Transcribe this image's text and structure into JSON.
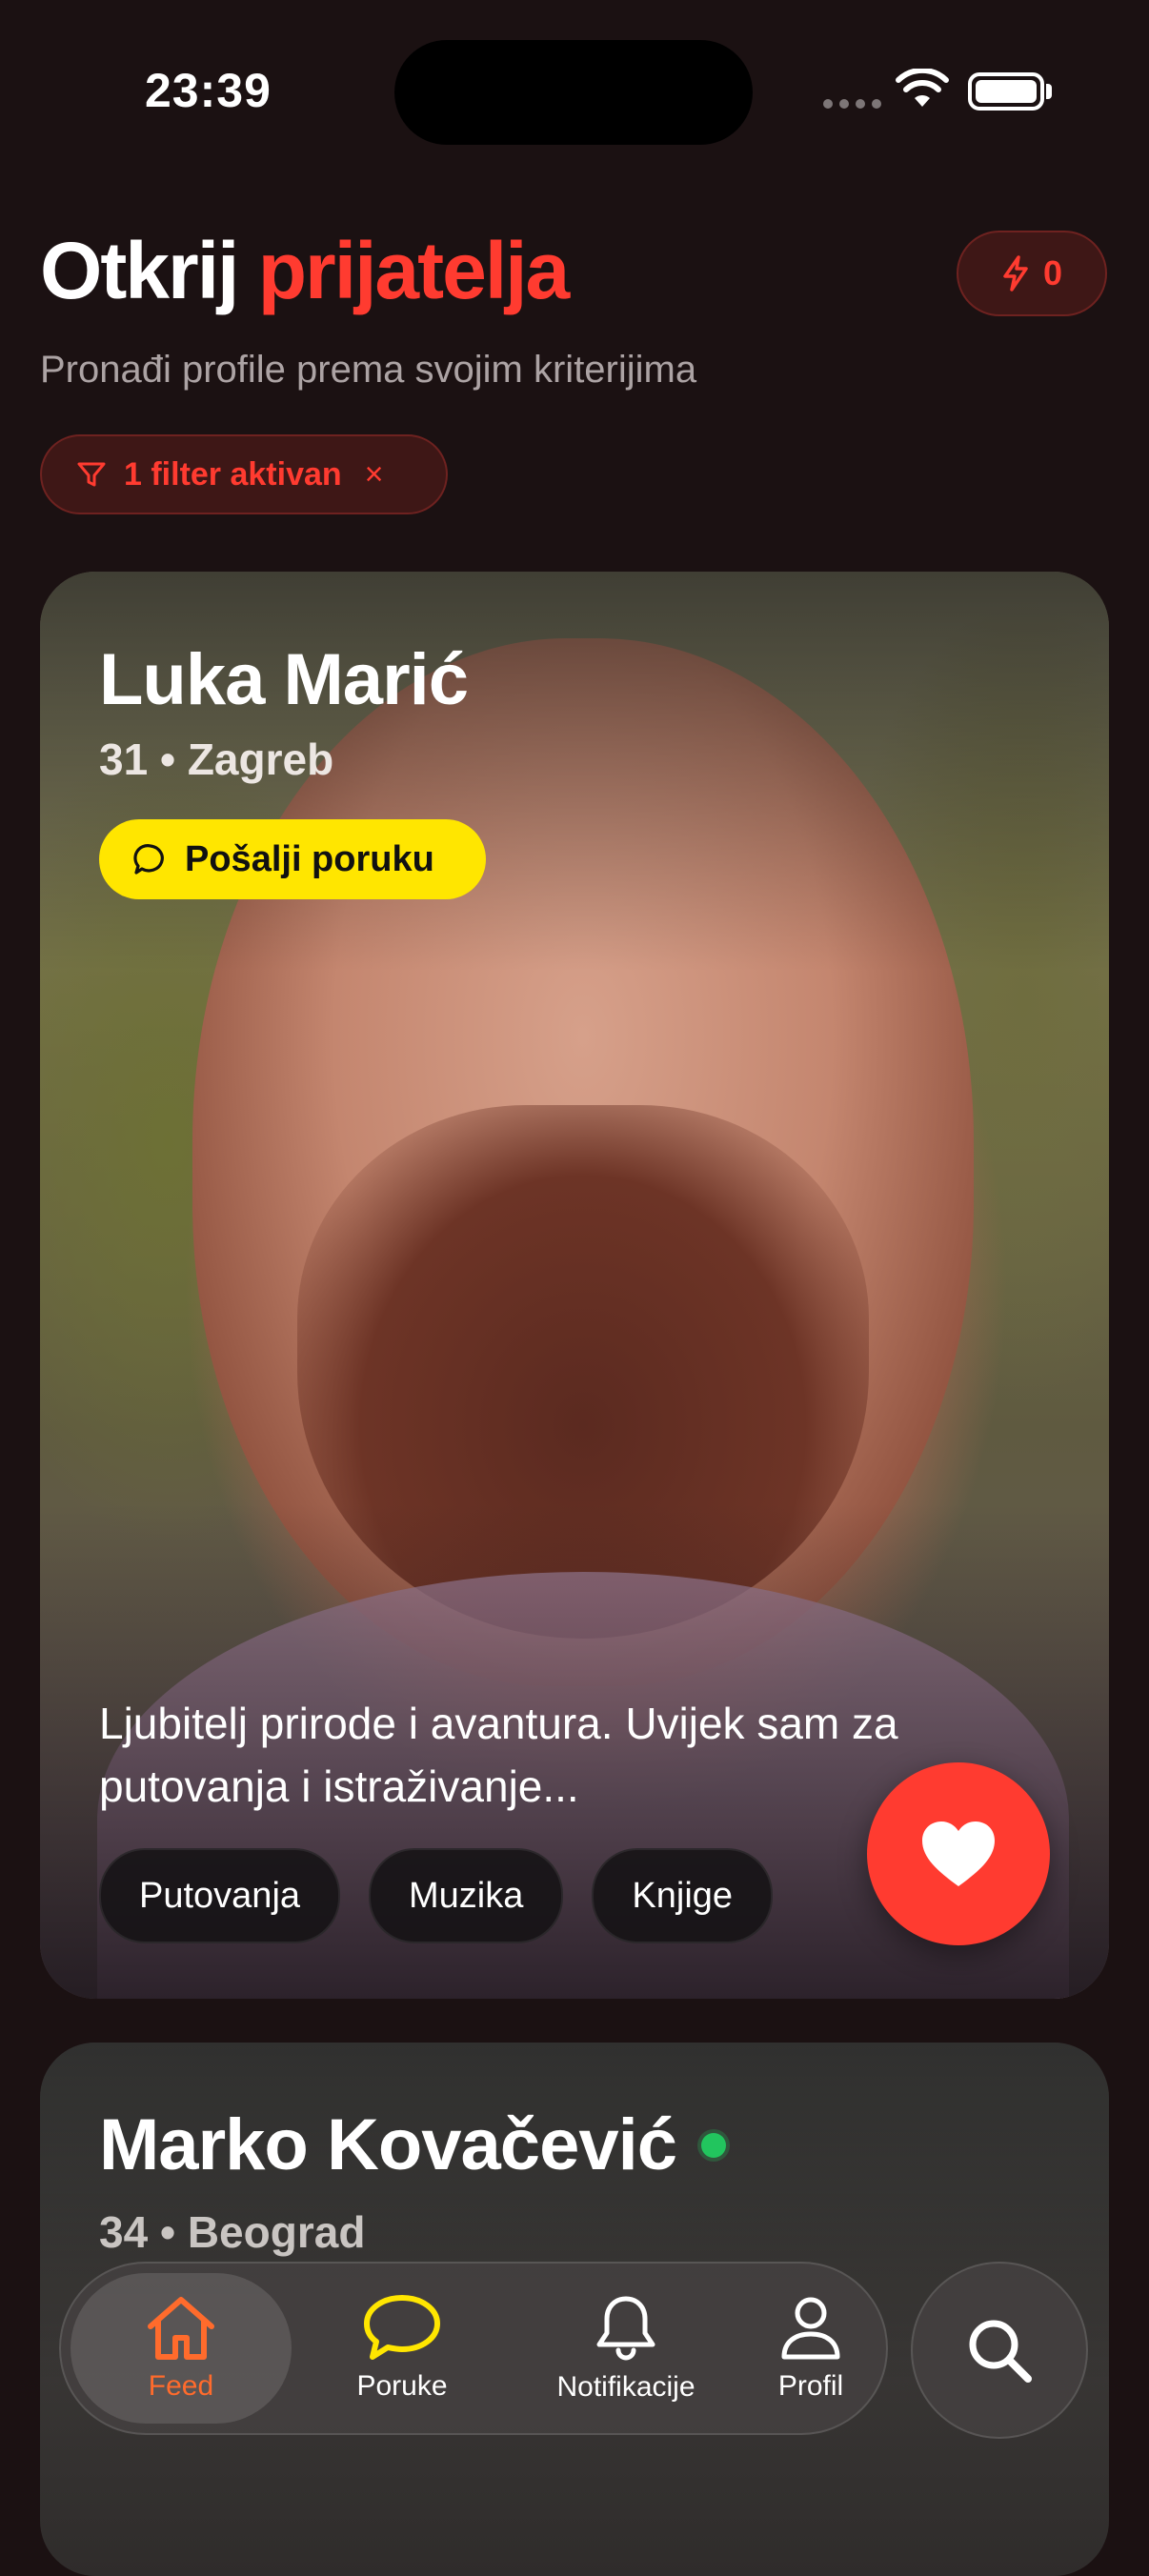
{
  "status_bar": {
    "time": "23:39"
  },
  "header": {
    "title_main": "Otkrij",
    "title_accent": "prijatelja",
    "subtitle": "Pronađi profile prema svojim kriterijima",
    "boost_count": "0",
    "filter_label": "1 filter aktivan",
    "filter_clear": "×"
  },
  "profiles": [
    {
      "name": "Luka Marić",
      "meta": "31 • Zagreb",
      "message_label": "Pošalji poruku",
      "bio": "Ljubitelj prirode i avantura. Uvijek sam za putovanja i istraživanje...",
      "tags": [
        "Putovanja",
        "Muzika",
        "Knjige"
      ]
    },
    {
      "name": "Marko Kovačević",
      "meta": "34 • Beograd",
      "online": true
    }
  ],
  "tabs": [
    {
      "label": "Feed",
      "icon": "home-icon",
      "active": true
    },
    {
      "label": "Poruke",
      "icon": "chat-icon"
    },
    {
      "label": "Notifikacije",
      "icon": "bell-icon"
    },
    {
      "label": "Profil",
      "icon": "person-icon"
    }
  ],
  "colors": {
    "accent": "#ff3b30",
    "message_button": "#ffe600",
    "active_tab": "#ff6b2c",
    "online": "#22c55e",
    "background": "#1b1112"
  }
}
